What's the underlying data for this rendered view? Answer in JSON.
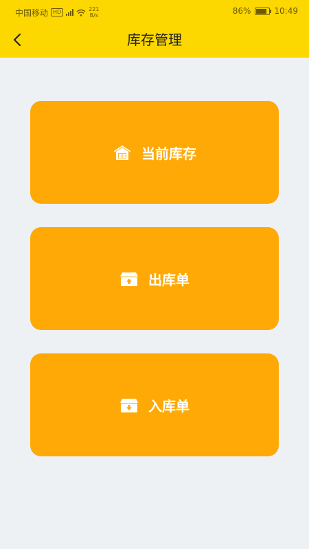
{
  "status_bar": {
    "carrier": "中国移动",
    "hd": "HD",
    "speed_value": "221",
    "speed_unit": "B/s",
    "battery": "86%",
    "time": "10:49"
  },
  "header": {
    "title": "库存管理"
  },
  "menu": {
    "items": [
      {
        "label": "当前库存",
        "icon": "warehouse-icon"
      },
      {
        "label": "出库单",
        "icon": "box-out-icon"
      },
      {
        "label": "入库单",
        "icon": "box-in-icon"
      }
    ]
  },
  "colors": {
    "header": "#fcd700",
    "card": "#ffa906",
    "background": "#eef1f4"
  }
}
